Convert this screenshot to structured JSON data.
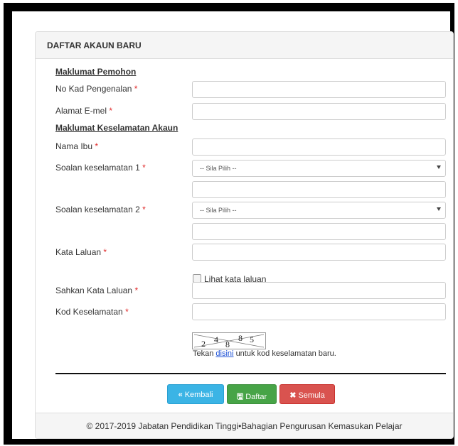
{
  "panel": {
    "title": "DAFTAR AKAUN BARU"
  },
  "sections": {
    "applicant": "Maklumat Pemohon",
    "security": "Maklumat Keselamatan Akaun"
  },
  "fields": {
    "ic_number": {
      "label": "No Kad Pengenalan",
      "value": ""
    },
    "email": {
      "label": "Alamat E-mel",
      "value": ""
    },
    "mother_name": {
      "label": "Nama Ibu",
      "value": ""
    },
    "security_q1": {
      "label": "Soalan keselamatan 1",
      "selected": "-- Sila Pilih --",
      "answer": ""
    },
    "security_q2": {
      "label": "Soalan keselamatan 2",
      "selected": "-- Sila Pilih --",
      "answer": ""
    },
    "password": {
      "label": "Kata Laluan",
      "value": ""
    },
    "show_password": {
      "label": "Lihat kata laluan",
      "checked": false
    },
    "confirm_password": {
      "label": "Sahkan Kata Laluan",
      "value": ""
    },
    "security_code": {
      "label": "Kod Keselamatan",
      "value": ""
    }
  },
  "required_marker": "*",
  "captcha": {
    "digits": [
      "2",
      "4",
      "8",
      "8",
      "5"
    ],
    "note_before": "Tekan",
    "note_link": "disini",
    "note_after": "untuk kod keselamatan baru."
  },
  "buttons": {
    "back": {
      "icon": "«",
      "label": "Kembali",
      "color": "#3bb4e5"
    },
    "register": {
      "icon": "🖫",
      "label": "Daftar",
      "color": "#47a447"
    },
    "reset": {
      "icon": "✖",
      "label": "Semula",
      "color": "#d9534f"
    }
  },
  "footer": {
    "text": "© 2017-2019 Jabatan Pendidikan Tinggi•Bahagian Pengurusan Kemasukan Pelajar"
  },
  "icons": {
    "back": "double-chevron-left-icon",
    "register": "save-icon",
    "reset": "close-icon",
    "select_caret": "caret-down-icon"
  }
}
